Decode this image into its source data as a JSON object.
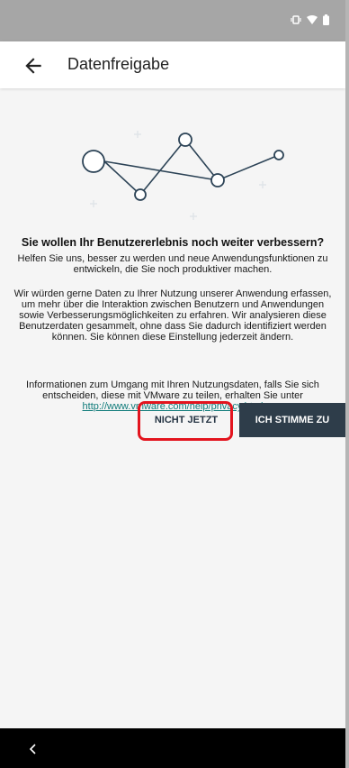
{
  "status_bar": {
    "icons": [
      "vibrate-icon",
      "wifi-icon",
      "battery-icon"
    ]
  },
  "app_bar": {
    "back_icon": "arrow-left-icon",
    "title": "Datenfreigabe"
  },
  "illustration": {
    "icon": "connected-nodes-illustration"
  },
  "content": {
    "heading": "Sie wollen Ihr Benutzererlebnis noch weiter verbessern?",
    "paragraph1": "Helfen Sie uns, besser zu werden und neue Anwendungsfunktionen zu entwickeln, die Sie noch produktiver machen.",
    "paragraph2": "Wir würden gerne Daten zu Ihrer Nutzung unserer Anwendung erfassen, um mehr über die Interaktion zwischen Benutzern und Anwendungen sowie Verbesserungsmöglichkeiten zu erfahren. Wir analysieren diese Benutzerdaten gesammelt, ohne dass Sie dadurch identifiziert werden können. Sie können diese Einstellung jederzeit ändern.",
    "paragraph3": "Informationen zum Umgang mit Ihren Nutzungsdaten, falls Sie sich entscheiden, diese mit VMware zu teilen, erhalten Sie unter",
    "privacy_link": "http://www.vmware.com/help/privacy.html"
  },
  "buttons": {
    "not_now": "NICHT JETZT",
    "agree": "ICH STIMME ZU"
  },
  "nav_bar": {
    "back_icon": "chevron-left-icon"
  },
  "colors": {
    "primary_button": "#2e3d4a",
    "link": "#0f7b7a",
    "highlight": "#e3141e",
    "status_bar": "#a6a6a6"
  }
}
